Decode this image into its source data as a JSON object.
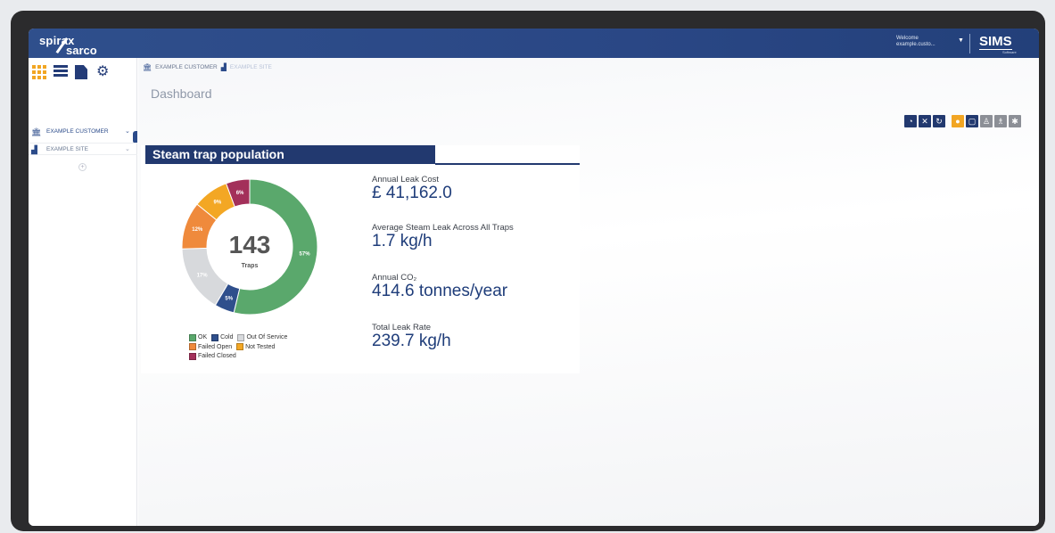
{
  "header": {
    "logo_line1": "spirax",
    "logo_line2": "sarco",
    "welcome_label": "Welcome",
    "welcome_user": "example.custo...",
    "app_logo": "SIMS",
    "app_logo_sub": "Software"
  },
  "sidebar": {
    "icons": [
      "grid-icon",
      "list-icon",
      "document-icon",
      "settings-icon"
    ],
    "tree": [
      {
        "label": "EXAMPLE CUSTOMER",
        "icon": "building-icon"
      },
      {
        "label": "EXAMPLE SITE",
        "icon": "site-icon"
      }
    ]
  },
  "breadcrumb": {
    "customer": "EXAMPLE CUSTOMER",
    "site": "EXAMPLE SITE"
  },
  "page": {
    "title": "Dashboard"
  },
  "toolbar": {
    "buttons_navy": [
      "dashboard-icon",
      "expand-icon",
      "refresh-icon"
    ],
    "buttons_other": [
      "marker-icon",
      "report-icon",
      "trap-icon",
      "trap-alt-icon",
      "leak-icon"
    ]
  },
  "panel": {
    "title": "Steam trap population",
    "total": "143",
    "total_label": "Traps"
  },
  "stats": [
    {
      "label": "Annual Leak Cost",
      "value": "£ 41,162.0"
    },
    {
      "label": "Average Steam Leak Across All Traps",
      "value": "1.7 kg/h"
    },
    {
      "label": "Annual CO₂",
      "value": "414.6 tonnes/year"
    },
    {
      "label": "Total Leak Rate",
      "value": "239.7 kg/h"
    }
  ],
  "chart_data": {
    "type": "pie",
    "center_value": "143",
    "center_label": "Traps",
    "slices": [
      {
        "name": "OK",
        "label": "57%",
        "percent": 57,
        "color": "#5aa86c"
      },
      {
        "name": "Cold",
        "label": "5%",
        "percent": 5,
        "color": "#2f4f8c"
      },
      {
        "name": "Out Of Service",
        "label": "17%",
        "percent": 17,
        "color": "#d7d9dc"
      },
      {
        "name": "Failed Open",
        "label": "12%",
        "percent": 12,
        "color": "#ef8a3c"
      },
      {
        "name": "Not Tested",
        "label": "9%",
        "percent": 9,
        "color": "#f3a724"
      },
      {
        "name": "Failed Closed",
        "label": "6%",
        "percent": 6,
        "color": "#a3305a"
      }
    ],
    "legend": [
      "OK",
      "Cold",
      "Out Of Service",
      "Failed Open",
      "Not Tested",
      "Failed Closed"
    ],
    "legend_placement": "bottom"
  }
}
